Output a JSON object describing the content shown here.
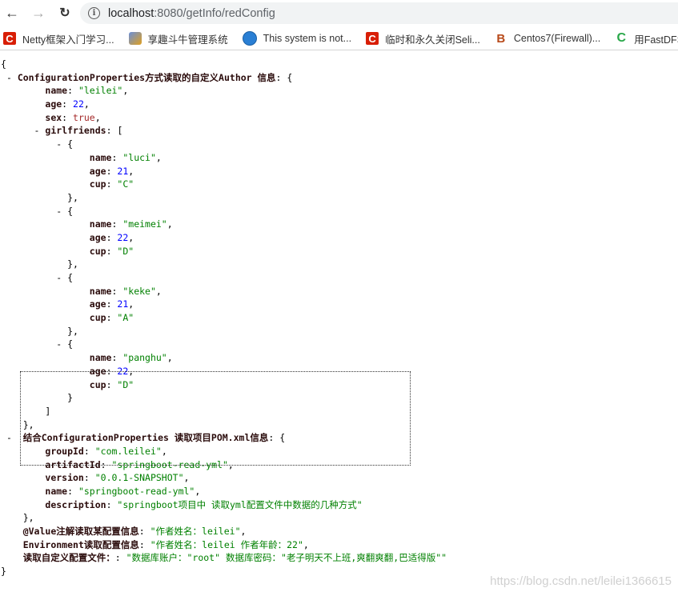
{
  "browser": {
    "back_icon": "←",
    "forward_icon": "→",
    "reload_icon": "C",
    "url_host": "localhost",
    "url_rest": ":8080/getInfo/redConfig"
  },
  "bookmarks": [
    {
      "icon": "csdn-c-icon",
      "label": "Netty框架入门学习..."
    },
    {
      "icon": "game-icon",
      "label": "享趣斗牛管理系统"
    },
    {
      "icon": "globe-icon",
      "label": "This system is not..."
    },
    {
      "icon": "csdn-c-icon",
      "label": "临时和永久关闭Seli..."
    },
    {
      "icon": "jb-icon",
      "label": "Centos7(Firewall)..."
    },
    {
      "icon": "green-c-icon",
      "label": "用FastDFS一"
    }
  ],
  "json": {
    "author_key": "ConfigurationProperties方式读取的自定义Author 信息",
    "author": {
      "name": "\"leilei\"",
      "age": "22",
      "sex": "true"
    },
    "girlfriends_key": "girlfriends",
    "girlfriends": [
      {
        "name": "\"luci\"",
        "age": "21",
        "cup": "\"C\""
      },
      {
        "name": "\"meimei\"",
        "age": "22",
        "cup": "\"D\""
      },
      {
        "name": "\"keke\"",
        "age": "21",
        "cup": "\"A\""
      },
      {
        "name": "\"panghu\"",
        "age": "22",
        "cup": "\"D\""
      }
    ],
    "pom_key": "结合ConfigurationProperties 读取项目POM.xml信息",
    "pom": {
      "groupId": "\"com.leilei\"",
      "artifactId": "\"springboot-read-yml\"",
      "version": "\"0.0.1-SNAPSHOT\"",
      "name": "\"springboot-read-yml\"",
      "description": "\"springboot项目中 读取yml配置文件中数据的几种方式\""
    },
    "value_key": "@Value注解读取某配置信息",
    "value_val": "\"作者姓名：leilei\"",
    "env_key": "Environment读取配置信息",
    "env_val": "\"作者姓名：leilei 作者年龄：22\"",
    "custom_key": "读取自定义配置文件：",
    "custom_val": "\"数据库账户：\"root\" 数据库密码：\"老子明天不上班,爽翻爽翻,巴适得版\"\""
  },
  "watermark": "https://blog.csdn.net/leilei1366615"
}
